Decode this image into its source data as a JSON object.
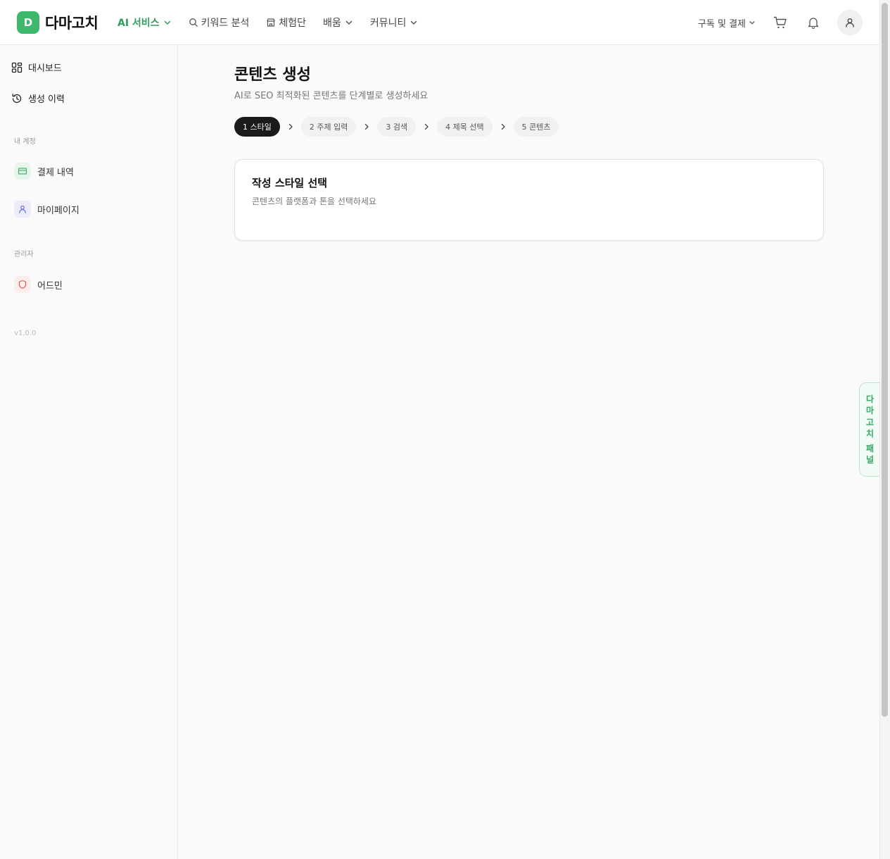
{
  "brand": {
    "badge": "D",
    "name": "다마고치",
    "accent": "#3fb86d"
  },
  "nav": {
    "ai_services": "AI 서비스",
    "keyword_analysis": "키워드 분석",
    "experience_group": "체험단",
    "learning": "배움",
    "community": "커뮤니티"
  },
  "header_right": {
    "subscription": "구독 및 결제",
    "icons": [
      "cart-icon",
      "bell-icon",
      "user-icon"
    ]
  },
  "sidebar": {
    "dashboard": "대시보드",
    "history": "생성 이력",
    "account_section": "내 계정",
    "payment_history": "결제 내역",
    "my_page": "마이페이지",
    "admin_section": "관리자",
    "admin": "어드민",
    "version": "v1.0.0"
  },
  "page": {
    "title": "콘텐츠 생성",
    "subtitle": "AI로 SEO 최적화된 콘텐츠를 단계별로 생성하세요"
  },
  "steps": [
    {
      "label": "1 스타일",
      "active": true
    },
    {
      "label": "2 주제 입력",
      "active": false
    },
    {
      "label": "3 검색",
      "active": false
    },
    {
      "label": "4 제목 선택",
      "active": false
    },
    {
      "label": "5 콘텐츠",
      "active": false
    }
  ],
  "card": {
    "title": "작성 스타일 선택",
    "subtitle": "콘텐츠의 플랫폼과 톤을 선택하세요"
  },
  "panel_tab": {
    "line1": "다마고치",
    "line2": "패널"
  }
}
